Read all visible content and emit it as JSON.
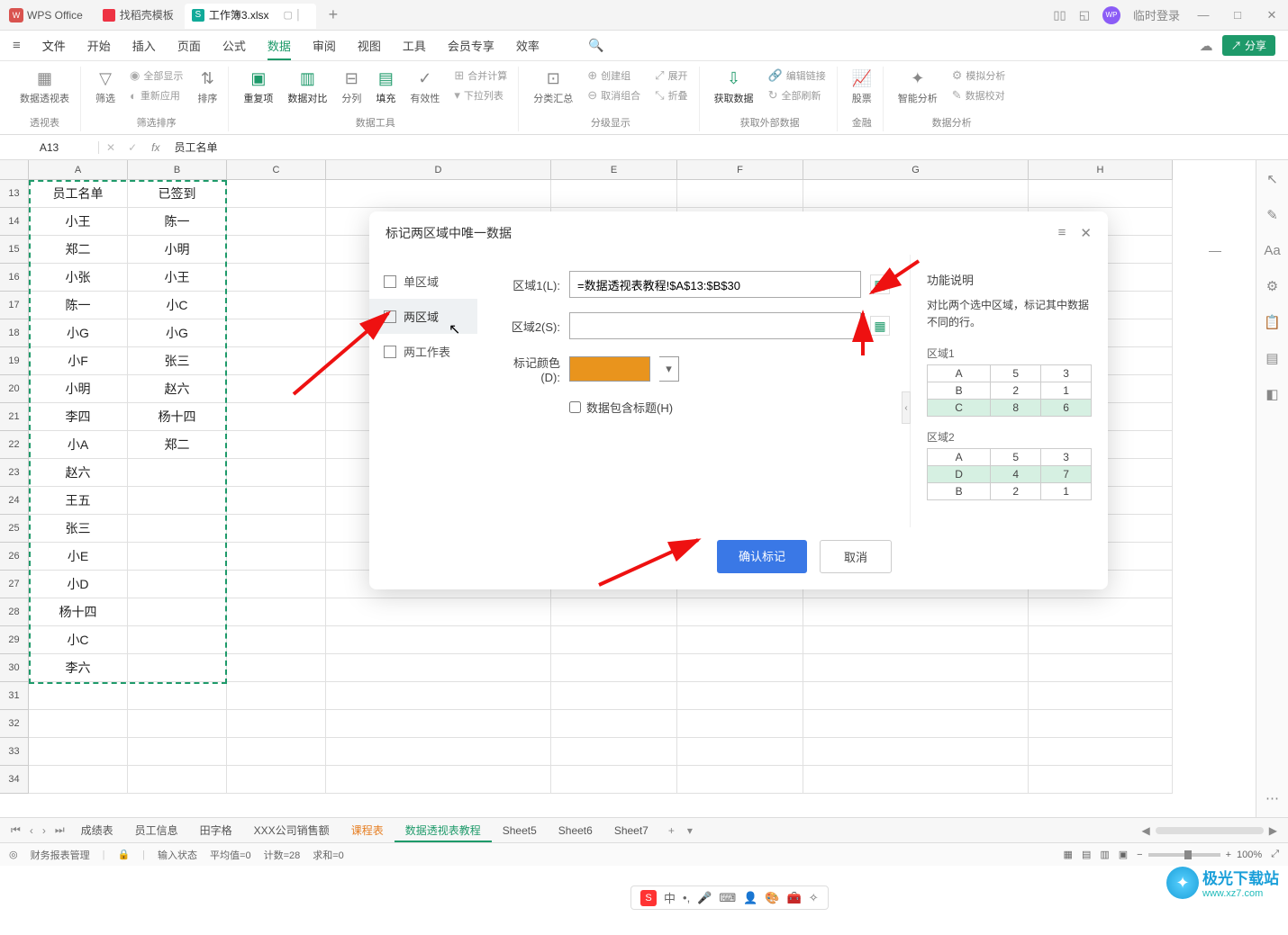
{
  "titlebar": {
    "wps_label": "WPS Office",
    "tab1": "找稻壳模板",
    "tab2": "工作簿3.xlsx",
    "login": "临时登录"
  },
  "menubar": {
    "file": "文件",
    "items": [
      "开始",
      "插入",
      "页面",
      "公式",
      "数据",
      "审阅",
      "视图",
      "工具",
      "会员专享",
      "效率"
    ],
    "active_index": 4,
    "share": "分享"
  },
  "ribbon": {
    "g1": {
      "pivot": "数据透视表",
      "group": "透视表"
    },
    "g2": {
      "filter": "筛选",
      "reapply": "重新应用",
      "showall": "全部显示",
      "sort": "排序",
      "group": "筛选排序"
    },
    "g3": {
      "dup": "重复项",
      "compare": "数据对比",
      "split": "分列",
      "fill": "填充",
      "validity": "有效性",
      "consolidate": "合并计算",
      "dropdown": "下拉列表",
      "group": "数据工具"
    },
    "g4": {
      "subtotal": "分类汇总",
      "create": "创建组",
      "ungroup_btn": "取消组合",
      "expand": "展开",
      "collapse": "折叠",
      "group": "分级显示"
    },
    "g5": {
      "getdata": "获取数据",
      "editlink": "编辑链接",
      "refreshall": "全部刷新",
      "group": "获取外部数据"
    },
    "g6": {
      "stock": "股票",
      "group": "金融"
    },
    "g7": {
      "smart": "智能分析",
      "sim": "模拟分析",
      "audit": "数据校对",
      "group": "数据分析"
    }
  },
  "formula": {
    "cell_ref": "A13",
    "fx": "fx",
    "value": "员工名单"
  },
  "column_headers": [
    "A",
    "B",
    "C",
    "D",
    "E",
    "F",
    "G",
    "H"
  ],
  "rows": [
    {
      "r": 13,
      "a": "员工名单",
      "b": "已签到"
    },
    {
      "r": 14,
      "a": "小王",
      "b": "陈一"
    },
    {
      "r": 15,
      "a": "郑二",
      "b": "小明"
    },
    {
      "r": 16,
      "a": "小张",
      "b": "小王"
    },
    {
      "r": 17,
      "a": "陈一",
      "b": "小C"
    },
    {
      "r": 18,
      "a": "小G",
      "b": "小G"
    },
    {
      "r": 19,
      "a": "小F",
      "b": "张三"
    },
    {
      "r": 20,
      "a": "小明",
      "b": "赵六"
    },
    {
      "r": 21,
      "a": "李四",
      "b": "杨十四"
    },
    {
      "r": 22,
      "a": "小A",
      "b": "郑二"
    },
    {
      "r": 23,
      "a": "赵六",
      "b": ""
    },
    {
      "r": 24,
      "a": "王五",
      "b": ""
    },
    {
      "r": 25,
      "a": "张三",
      "b": ""
    },
    {
      "r": 26,
      "a": "小E",
      "b": ""
    },
    {
      "r": 27,
      "a": "小D",
      "b": ""
    },
    {
      "r": 28,
      "a": "杨十四",
      "b": ""
    },
    {
      "r": 29,
      "a": "小C",
      "b": ""
    },
    {
      "r": 30,
      "a": "李六",
      "b": ""
    },
    {
      "r": 31,
      "a": "",
      "b": ""
    },
    {
      "r": 32,
      "a": "",
      "b": ""
    },
    {
      "r": 33,
      "a": "",
      "b": ""
    },
    {
      "r": 34,
      "a": "",
      "b": ""
    }
  ],
  "dialog": {
    "title": "标记两区域中唯一数据",
    "side": [
      "单区域",
      "两区域",
      "两工作表"
    ],
    "side_active": 1,
    "label_r1": "区域1(L):",
    "label_r2": "区域2(S):",
    "val_r1": "=数据透视表教程!$A$13:$B$30",
    "val_r2": "",
    "label_color": "标记颜色(D):",
    "check_label": "数据包含标题(H)",
    "ok": "确认标记",
    "cancel": "取消",
    "help_title": "功能说明",
    "help_desc": "对比两个选中区域，标记其中数据不同的行。",
    "region1_label": "区域1",
    "region2_label": "区域2",
    "region1_rows": [
      [
        "A",
        "5",
        "3"
      ],
      [
        "B",
        "2",
        "1"
      ],
      [
        "C",
        "8",
        "6"
      ]
    ],
    "region1_hl": [
      2
    ],
    "region2_rows": [
      [
        "A",
        "5",
        "3"
      ],
      [
        "D",
        "4",
        "7"
      ],
      [
        "B",
        "2",
        "1"
      ]
    ],
    "region2_hl": [
      1
    ]
  },
  "sheet_tabs": {
    "items": [
      "成绩表",
      "员工信息",
      "田字格",
      "XXX公司销售额",
      "课程表",
      "数据透视表教程",
      "Sheet5",
      "Sheet6",
      "Sheet7"
    ],
    "active_index": 5
  },
  "status": {
    "book": "财务报表管理",
    "mode": "输入状态",
    "avg": "平均值=0",
    "count": "计数=28",
    "sum": "求和=0",
    "zoom": "100%"
  },
  "watermark": {
    "text": "极光下载站",
    "url": "www.xz7.com"
  },
  "ime": {
    "logo": "S",
    "zh": "中"
  }
}
